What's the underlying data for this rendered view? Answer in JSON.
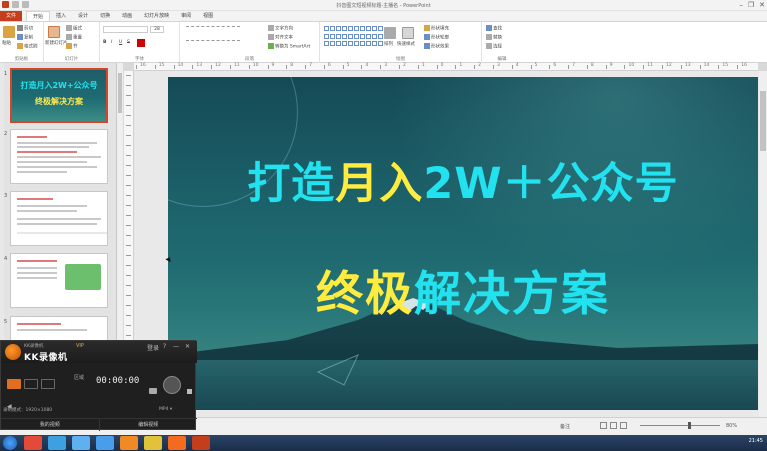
{
  "titlebar": {
    "title": "抖音图文短视频标题-主播名 - PowerPoint",
    "minimize": "–",
    "restore": "❐",
    "close": "✕"
  },
  "tabs": [
    "文件",
    "开始",
    "插入",
    "设计",
    "切换",
    "动画",
    "幻灯片放映",
    "审阅",
    "视图"
  ],
  "ribbon": {
    "clipboard": {
      "paste": "粘贴",
      "cut": "剪切",
      "copy": "复制",
      "format_painter": "格式刷",
      "label": "剪贴板"
    },
    "slides": {
      "new_slide": "新建幻灯片",
      "layout": "版式",
      "reset": "重置",
      "section": "节",
      "label": "幻灯片"
    },
    "font": {
      "font_name": "",
      "font_size": "28",
      "bold": "B",
      "italic": "I",
      "underline": "U",
      "strike": "S",
      "label": "字体"
    },
    "paragraph": {
      "text_direction": "文字方向",
      "align_text": "对齐文本",
      "smartart": "转换为 SmartArt",
      "label": "段落"
    },
    "drawing": {
      "arrange": "排列",
      "quick_styles": "快速样式",
      "shape_fill": "形状填充",
      "shape_outline": "形状轮廓",
      "shape_effects": "形状效果",
      "label": "绘图"
    },
    "editing": {
      "find": "查找",
      "replace": "替换",
      "select": "选择",
      "label": "编辑"
    }
  },
  "ruler_numbers": [
    "16",
    "15",
    "14",
    "13",
    "12",
    "11",
    "10",
    "9",
    "8",
    "7",
    "6",
    "5",
    "4",
    "3",
    "2",
    "1",
    "0",
    "1",
    "2",
    "3",
    "4",
    "5",
    "6",
    "7",
    "8",
    "9",
    "10",
    "11",
    "12",
    "13",
    "14",
    "15",
    "16"
  ],
  "thumbnails": [
    {
      "num": "1",
      "title_line1": "打造月入2W+公众号",
      "title_line2": "终极解决方案"
    },
    {
      "num": "2"
    },
    {
      "num": "3"
    },
    {
      "num": "4"
    },
    {
      "num": "5"
    }
  ],
  "slide": {
    "line1_part1": "打造",
    "line1_part2": "月入",
    "line1_part3": "2W＋公众号",
    "line2_part1": "终极",
    "line2_part2": "解决方案"
  },
  "statusbar": {
    "notes": "备注",
    "zoom": "80%"
  },
  "kk_recorder": {
    "brand": "KK录像机",
    "brand_small": "KK录像机",
    "vip": "VIP",
    "login": "登录",
    "help": "?",
    "minimize": "—",
    "close": "✕",
    "timer": "00:00:00",
    "label_area": "区域",
    "status_left": "录制模式：1920×1080",
    "status_right": "MP4  ▾",
    "footer_left": "我的视频",
    "footer_right": "编辑视频"
  },
  "taskbar": {
    "time": "21:45"
  },
  "colors": {
    "title_cyan": "#22e2f0",
    "title_yellow": "#ffec3f",
    "file_tab": "#c43e1c",
    "selected_thumb_border": "#d24726"
  }
}
